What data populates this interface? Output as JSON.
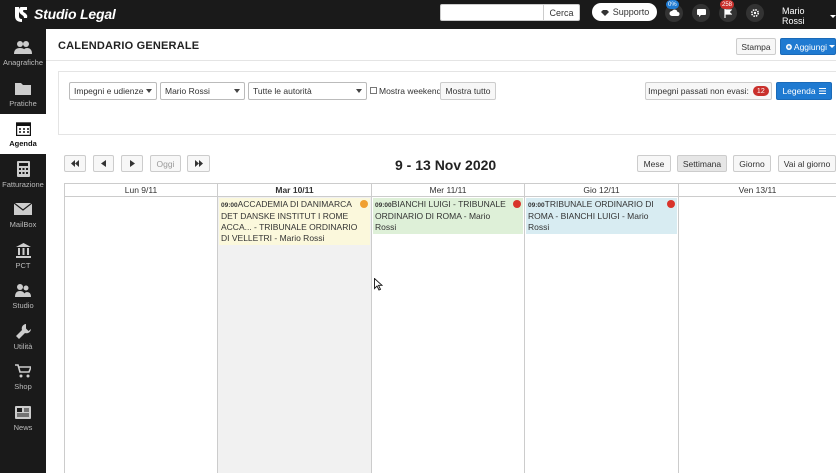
{
  "app": {
    "name": "Studio Legal"
  },
  "topbar": {
    "search_placeholder": "",
    "search_button": "Cerca",
    "support_label": "Supporto",
    "badges": {
      "cloud": "0%",
      "bell": "258"
    },
    "user_name": "Mario Rossi"
  },
  "sidebar": {
    "items": [
      {
        "label": "Anagrafiche",
        "icon": "users-icon"
      },
      {
        "label": "Pratiche",
        "icon": "folder-icon"
      },
      {
        "label": "Agenda",
        "icon": "calendar-icon",
        "active": true
      },
      {
        "label": "Fatturazione",
        "icon": "calculator-icon"
      },
      {
        "label": "MailBox",
        "icon": "envelope-icon"
      },
      {
        "label": "PCT",
        "icon": "bank-icon"
      },
      {
        "label": "Studio",
        "icon": "people-icon"
      },
      {
        "label": "Utilità",
        "icon": "wrench-icon"
      },
      {
        "label": "Shop",
        "icon": "cart-icon"
      },
      {
        "label": "News",
        "icon": "newspaper-icon"
      }
    ]
  },
  "header": {
    "title": "CALENDARIO GENERALE",
    "print_label": "Stampa",
    "add_label": "Aggiungi"
  },
  "filters": {
    "type_select": "Impegni e udienze",
    "user_select": "Mario Rossi",
    "authority_select": "Tutte le autorità",
    "weekend_label": "Mostra weekend",
    "show_all_label": "Mostra tutto",
    "overdue_label": "Impegni passati non evasi:",
    "overdue_count": "12",
    "legend_label": "Legenda"
  },
  "calendar": {
    "today_label": "Oggi",
    "range_title": "9 - 13 Nov 2020",
    "views": [
      "Mese",
      "Settimana",
      "Giorno"
    ],
    "goto_label": "Vai al giorno",
    "days": [
      {
        "label": "Lun 9/11"
      },
      {
        "label": "Mar 10/11",
        "today": true
      },
      {
        "label": "Mer 11/11"
      },
      {
        "label": "Gio 12/11"
      },
      {
        "label": "Ven 13/11"
      }
    ],
    "events": [
      {
        "day": 1,
        "time": "09:00",
        "text": "ACCADEMIA DI DANIMARCA DET DANSKE INSTITUT I ROME ACCA... - TRIBUNALE ORDINARIO DI VELLETRI - Mario Rossi",
        "bg": "#fbf8dc",
        "dot": "#f0a030"
      },
      {
        "day": 2,
        "time": "09:00",
        "text": "BIANCHI LUIGI - TRIBUNALE ORDINARIO DI ROMA - Mario Rossi",
        "bg": "#def0d8",
        "dot": "#d9342b"
      },
      {
        "day": 3,
        "time": "09:00",
        "text": "TRIBUNALE ORDINARIO DI ROMA - BIANCHI LUIGI - Mario Rossi",
        "bg": "#d8ecf2",
        "dot": "#d9342b"
      }
    ]
  },
  "colors": {
    "dark": "#1a1a1a",
    "accent": "#1f7ad1",
    "badge": "#c9302c"
  }
}
